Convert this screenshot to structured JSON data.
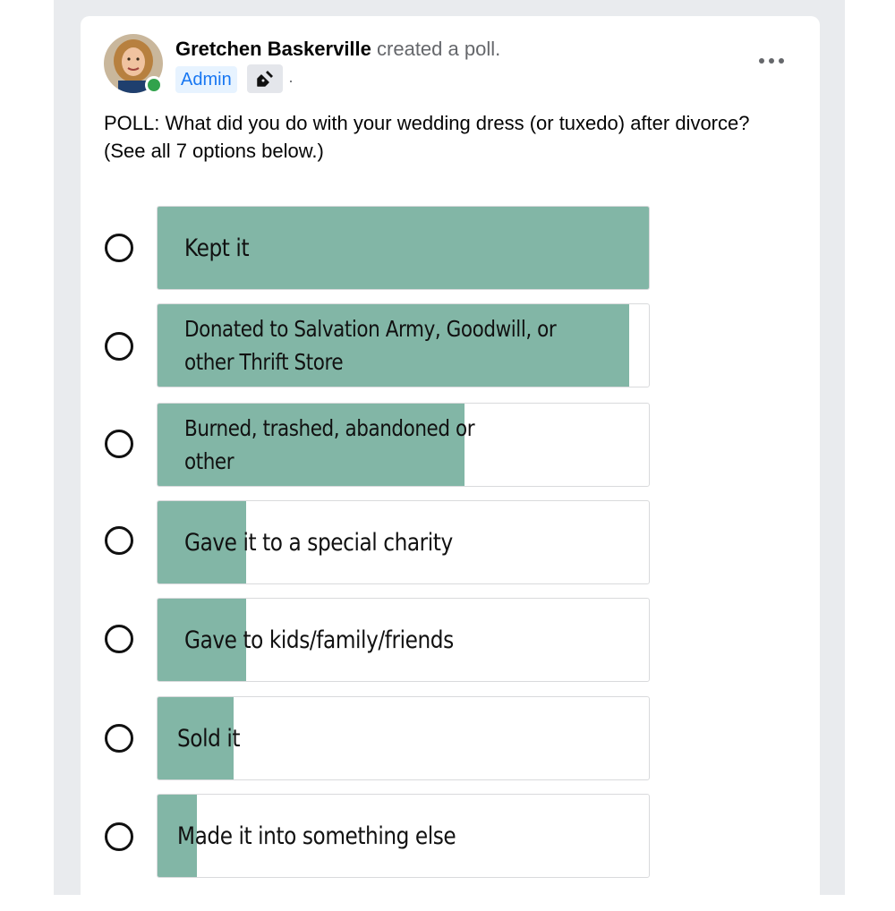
{
  "post": {
    "author_name": "Gretchen Baskerville",
    "action_text": " created a poll.",
    "badge_label": "Admin",
    "separator": "·",
    "text": "POLL:  What did you do with your wedding dress (or tuxedo) after divorce? (See all 7 options below.)",
    "more_icon": "more-horizontal-icon",
    "pen_icon": "pen-nib-icon",
    "avatar_icon": "profile-avatar",
    "colors": {
      "fill": "#82b6a6",
      "badge_bg": "#e7f3ff",
      "badge_text": "#1877f2",
      "online": "#31a24c"
    }
  },
  "poll": {
    "options": [
      {
        "label": "Kept it",
        "share": 1.0
      },
      {
        "label": "Donated to Salvation Army, Goodwill, or other Thrift Store",
        "share": 0.96
      },
      {
        "label": "Burned, trashed, abandoned or other",
        "share": 0.625
      },
      {
        "label": "Gave it to a special charity",
        "share": 0.18
      },
      {
        "label": "Gave to kids/family/friends",
        "share": 0.18
      },
      {
        "label": "Sold it",
        "share": 0.155
      },
      {
        "label": "Made it into something else",
        "share": 0.08
      }
    ]
  }
}
